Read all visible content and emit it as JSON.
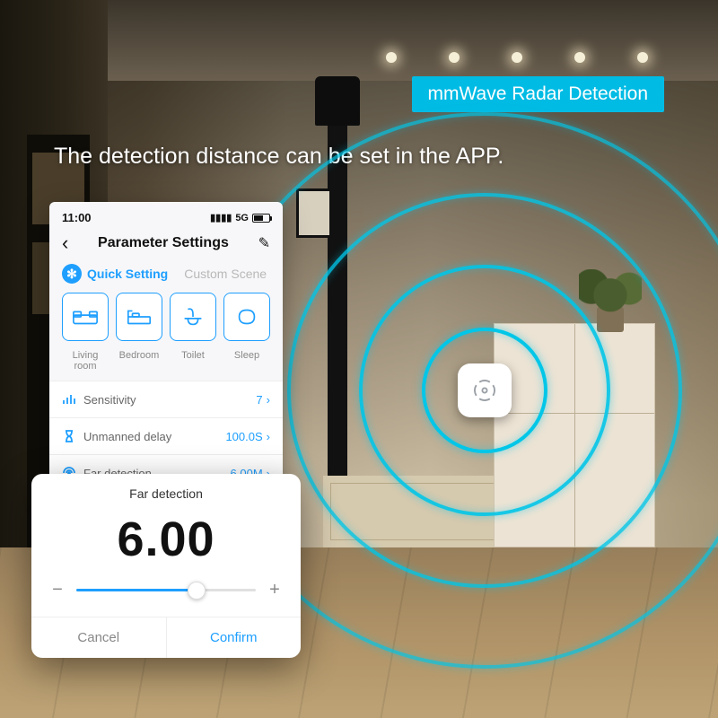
{
  "badge": "mmWave Radar Detection",
  "headline": "The detection distance can be set in the APP.",
  "radar": {
    "accent": "#00c6e8",
    "ring_count": 4
  },
  "phone": {
    "status": {
      "time": "11:00",
      "network": "5G"
    },
    "appbar": {
      "title": "Parameter Settings"
    },
    "tabs": {
      "active": "Quick Setting",
      "inactive": "Custom Scene"
    },
    "scenes": [
      "Living room",
      "Bedroom",
      "Toilet",
      "Sleep"
    ],
    "rows": {
      "sensitivity": {
        "label": "Sensitivity",
        "value": "7"
      },
      "unmanned": {
        "label": "Unmanned delay",
        "value": "100.0S"
      },
      "far": {
        "label": "Far detection",
        "value": "6.00M"
      }
    }
  },
  "sheet": {
    "title": "Far detection",
    "value": "6.00",
    "slider_percent": 67,
    "cancel": "Cancel",
    "confirm": "Confirm"
  }
}
